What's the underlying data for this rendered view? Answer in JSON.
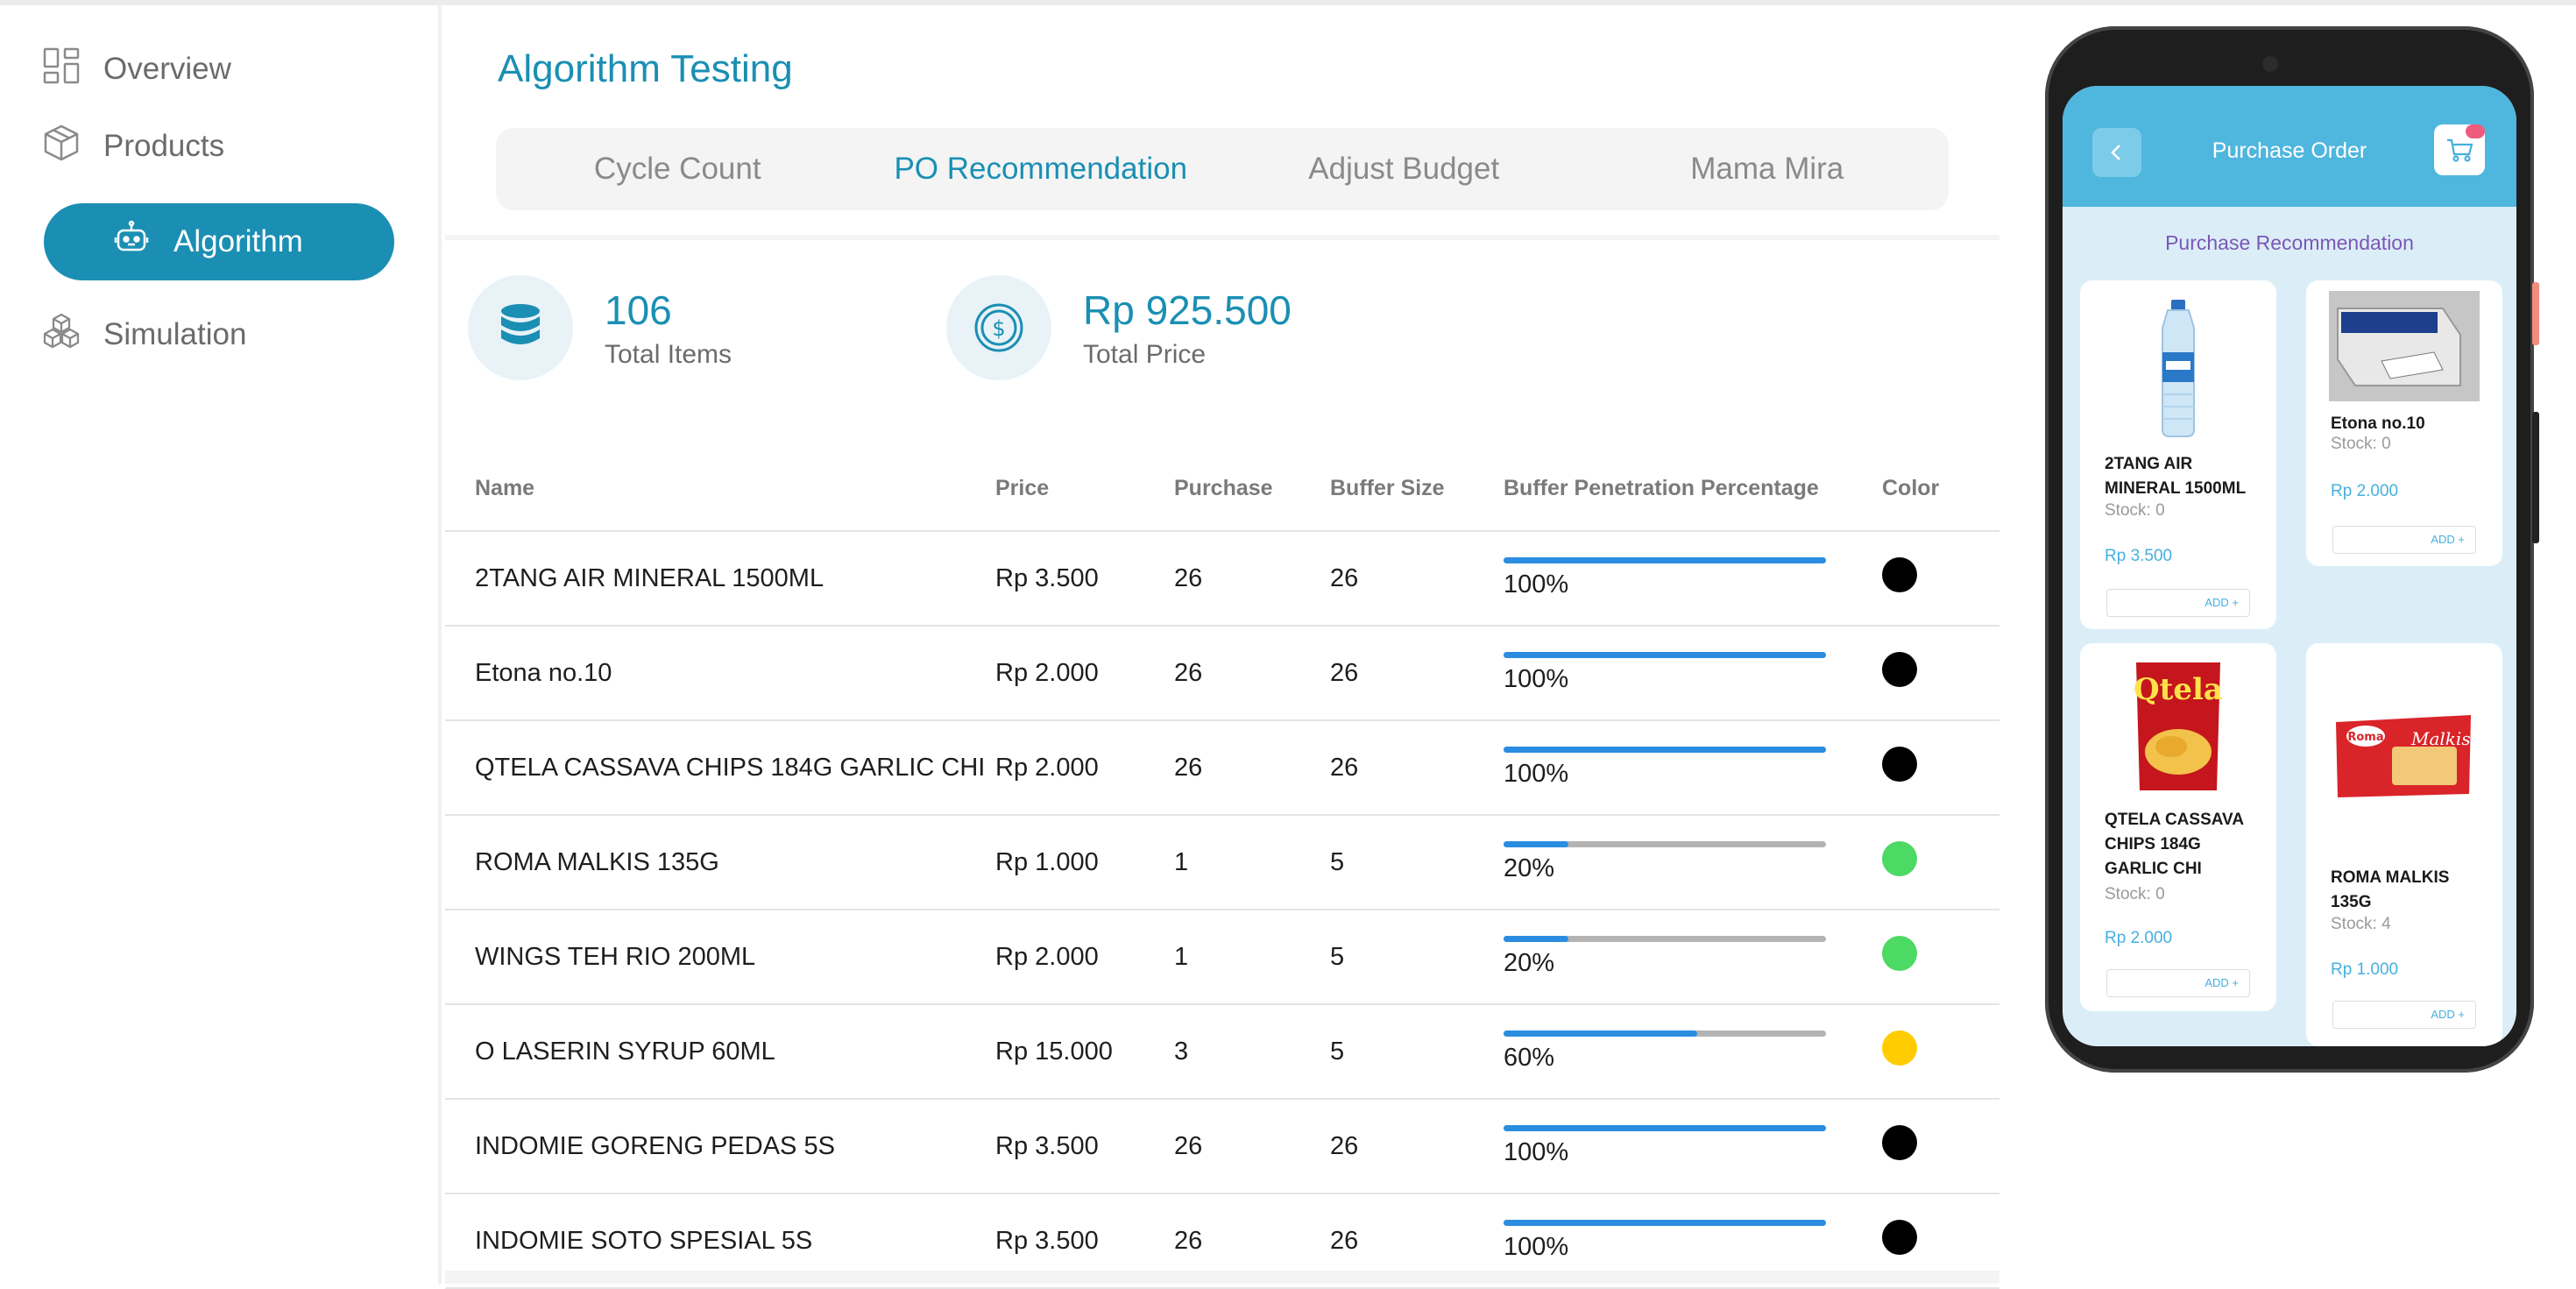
{
  "sidebar": {
    "items": [
      {
        "label": "Overview",
        "icon": "dashboard-grid-icon"
      },
      {
        "label": "Products",
        "icon": "box-icon"
      },
      {
        "label": "Algorithm",
        "icon": "robot-icon",
        "active": true
      },
      {
        "label": "Simulation",
        "icon": "cubes-icon"
      }
    ]
  },
  "header": {
    "title": "Algorithm Testing",
    "tabs": [
      "Cycle Count",
      "PO Recommendation",
      "Adjust Budget",
      "Mama Mira"
    ],
    "active_tab": "PO Recommendation"
  },
  "stats": {
    "total_items": {
      "value": "106",
      "label": "Total Items",
      "icon": "database-icon"
    },
    "total_price": {
      "value": "Rp 925.500",
      "label": "Total Price",
      "icon": "dollar-coin-icon"
    }
  },
  "table": {
    "headers": [
      "Name",
      "Price",
      "Purchase",
      "Buffer Size",
      "Buffer Penetration Percentage",
      "Color"
    ],
    "rows": [
      {
        "name": "2TANG AIR MINERAL 1500ML",
        "price": "Rp 3.500",
        "purchase": "26",
        "buffer": "26",
        "pct": "100%",
        "fill": 1.0,
        "color": "#000000"
      },
      {
        "name": "Etona no.10",
        "price": "Rp 2.000",
        "purchase": "26",
        "buffer": "26",
        "pct": "100%",
        "fill": 1.0,
        "color": "#000000"
      },
      {
        "name": "QTELA CASSAVA CHIPS 184G GARLIC CHI",
        "price": "Rp 2.000",
        "purchase": "26",
        "buffer": "26",
        "pct": "100%",
        "fill": 1.0,
        "color": "#000000"
      },
      {
        "name": "ROMA MALKIS 135G",
        "price": "Rp 1.000",
        "purchase": "1",
        "buffer": "5",
        "pct": "20%",
        "fill": 0.2,
        "color": "#4cd964"
      },
      {
        "name": "WINGS TEH RIO 200ML",
        "price": "Rp 2.000",
        "purchase": "1",
        "buffer": "5",
        "pct": "20%",
        "fill": 0.2,
        "color": "#4cd964"
      },
      {
        "name": "O LASERIN SYRUP 60ML",
        "price": "Rp 15.000",
        "purchase": "3",
        "buffer": "5",
        "pct": "60%",
        "fill": 0.6,
        "color": "#ffcc00"
      },
      {
        "name": "INDOMIE GORENG PEDAS 5S",
        "price": "Rp 3.500",
        "purchase": "26",
        "buffer": "26",
        "pct": "100%",
        "fill": 1.0,
        "color": "#000000"
      },
      {
        "name": "INDOMIE SOTO SPESIAL 5S",
        "price": "Rp 3.500",
        "purchase": "26",
        "buffer": "26",
        "pct": "100%",
        "fill": 1.0,
        "color": "#000000"
      }
    ]
  },
  "phone": {
    "title": "Purchase Order",
    "section_title": "Purchase Recommendation",
    "products": [
      {
        "name": "2TANG AIR MINERAL 1500ML",
        "stock": "Stock: 0",
        "price": "Rp 3.500",
        "add": "ADD +"
      },
      {
        "name": "Etona no.10",
        "stock": "Stock: 0",
        "price": "Rp 2.000",
        "add": "ADD +"
      },
      {
        "name": "QTELA CASSAVA CHIPS 184G GARLIC CHI",
        "stock": "Stock: 0",
        "price": "Rp 2.000",
        "add": "ADD +"
      },
      {
        "name": "ROMA MALKIS 135G",
        "stock": "Stock: 4",
        "price": "Rp 1.000",
        "add": "ADD +"
      }
    ]
  },
  "colors": {
    "accent": "#1a8fb3",
    "bar_fill": "#2a8de0",
    "bar_track": "#b3b3b3",
    "phone_header": "#4fb6de"
  }
}
